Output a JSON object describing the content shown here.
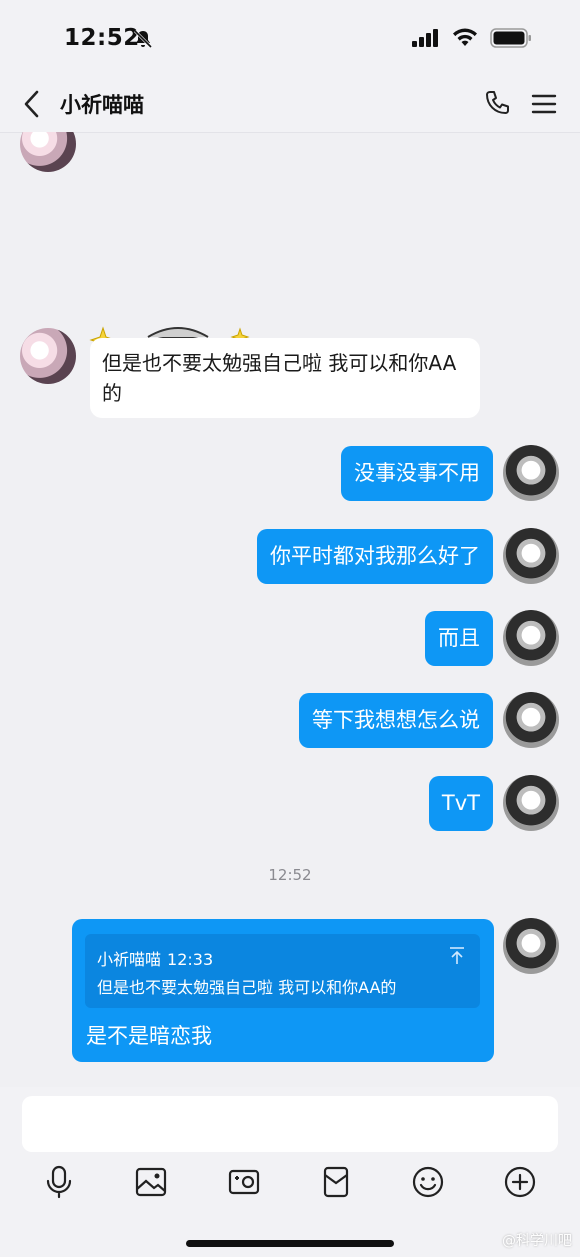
{
  "status_bar": {
    "time": "12:52"
  },
  "header": {
    "title": "小祈喵喵"
  },
  "icons": {
    "back": "chevron-left-icon",
    "call": "phone-icon",
    "menu": "menu-icon",
    "mic": "microphone-icon",
    "image": "image-icon",
    "camera": "camera-icon",
    "red_packet": "red-packet-icon",
    "emoji": "emoji-icon",
    "more": "plus-circle-icon"
  },
  "messages": {
    "incoming_text": "但是也不要太勉强自己啦 我可以和你AA的",
    "out_1": "没事没事不用",
    "out_2": "你平时都对我那么好了",
    "out_3": "而且",
    "out_4": "等下我想想怎么说",
    "out_5": "TvT",
    "time_divider": "12:52",
    "reply": {
      "quote_author": "小祈喵喵",
      "quote_time": "12:33",
      "quote_text": "但是也不要太勉强自己啦 我可以和你AA的",
      "text": "是不是暗恋我"
    }
  },
  "watermark": "@科学川吧",
  "colors": {
    "accent": "#0e97f5",
    "background": "#f0f0f3"
  }
}
